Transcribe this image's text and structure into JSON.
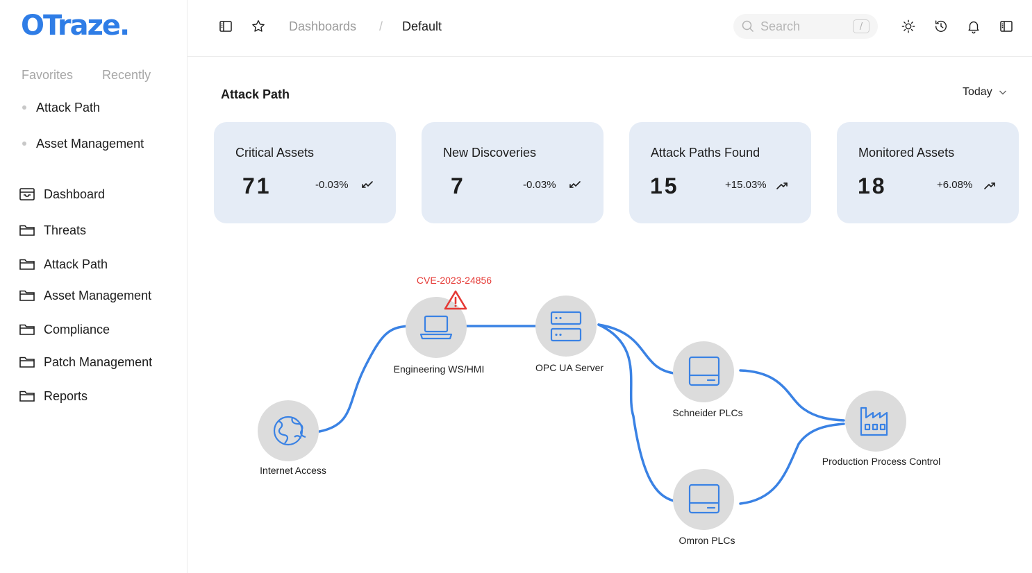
{
  "brand": {
    "logo_text": "OTraze.",
    "color": "#2f7de6"
  },
  "sidebar": {
    "tabs": [
      "Favorites",
      "Recently"
    ],
    "favorites": [
      "Attack Path",
      "Asset Management"
    ],
    "nav": [
      {
        "label": "Dashboard",
        "icon": "inbox-icon"
      },
      {
        "label": "Threats",
        "icon": "folder-icon"
      },
      {
        "label": "Attack Path",
        "icon": "folder-icon"
      },
      {
        "label": "Asset Management",
        "icon": "folder-icon"
      },
      {
        "label": "Compliance",
        "icon": "folder-icon"
      },
      {
        "label": "Patch Management",
        "icon": "folder-icon"
      },
      {
        "label": "Reports",
        "icon": "folder-icon"
      }
    ]
  },
  "header": {
    "breadcrumb_parent": "Dashboards",
    "breadcrumb_sep": "/",
    "breadcrumb_current": "Default",
    "search_placeholder": "Search",
    "search_shortcut": "/"
  },
  "main": {
    "title": "Attack Path",
    "range": "Today",
    "cards": [
      {
        "title": "Critical Assets",
        "value": "71",
        "change": "-0.03%",
        "trend": "down"
      },
      {
        "title": "New Discoveries",
        "value": "7",
        "change": "-0.03%",
        "trend": "down"
      },
      {
        "title": "Attack Paths Found",
        "value": "15",
        "change": "+15.03%",
        "trend": "up"
      },
      {
        "title": "Monitored Assets",
        "value": "18",
        "change": "+6.08%",
        "trend": "up"
      }
    ]
  },
  "graph": {
    "vulnerability_label": "CVE-2023-24856",
    "nodes": [
      {
        "id": "internet",
        "label": "Internet Access",
        "icon": "globe-icon"
      },
      {
        "id": "hmi",
        "label": "Engineering WS/HMI",
        "icon": "laptop-icon"
      },
      {
        "id": "opc",
        "label": "OPC UA Server",
        "icon": "server-icon"
      },
      {
        "id": "schneider",
        "label": "Schneider PLCs",
        "icon": "plc-icon"
      },
      {
        "id": "omron",
        "label": "Omron PLCs",
        "icon": "plc-icon"
      },
      {
        "id": "production",
        "label": "Production Process Control",
        "icon": "factory-icon"
      }
    ],
    "colors": {
      "edge": "#3a82e4",
      "node_fill": "#dcdcdc",
      "icon": "#3a82e4",
      "alert": "#e53935"
    }
  }
}
